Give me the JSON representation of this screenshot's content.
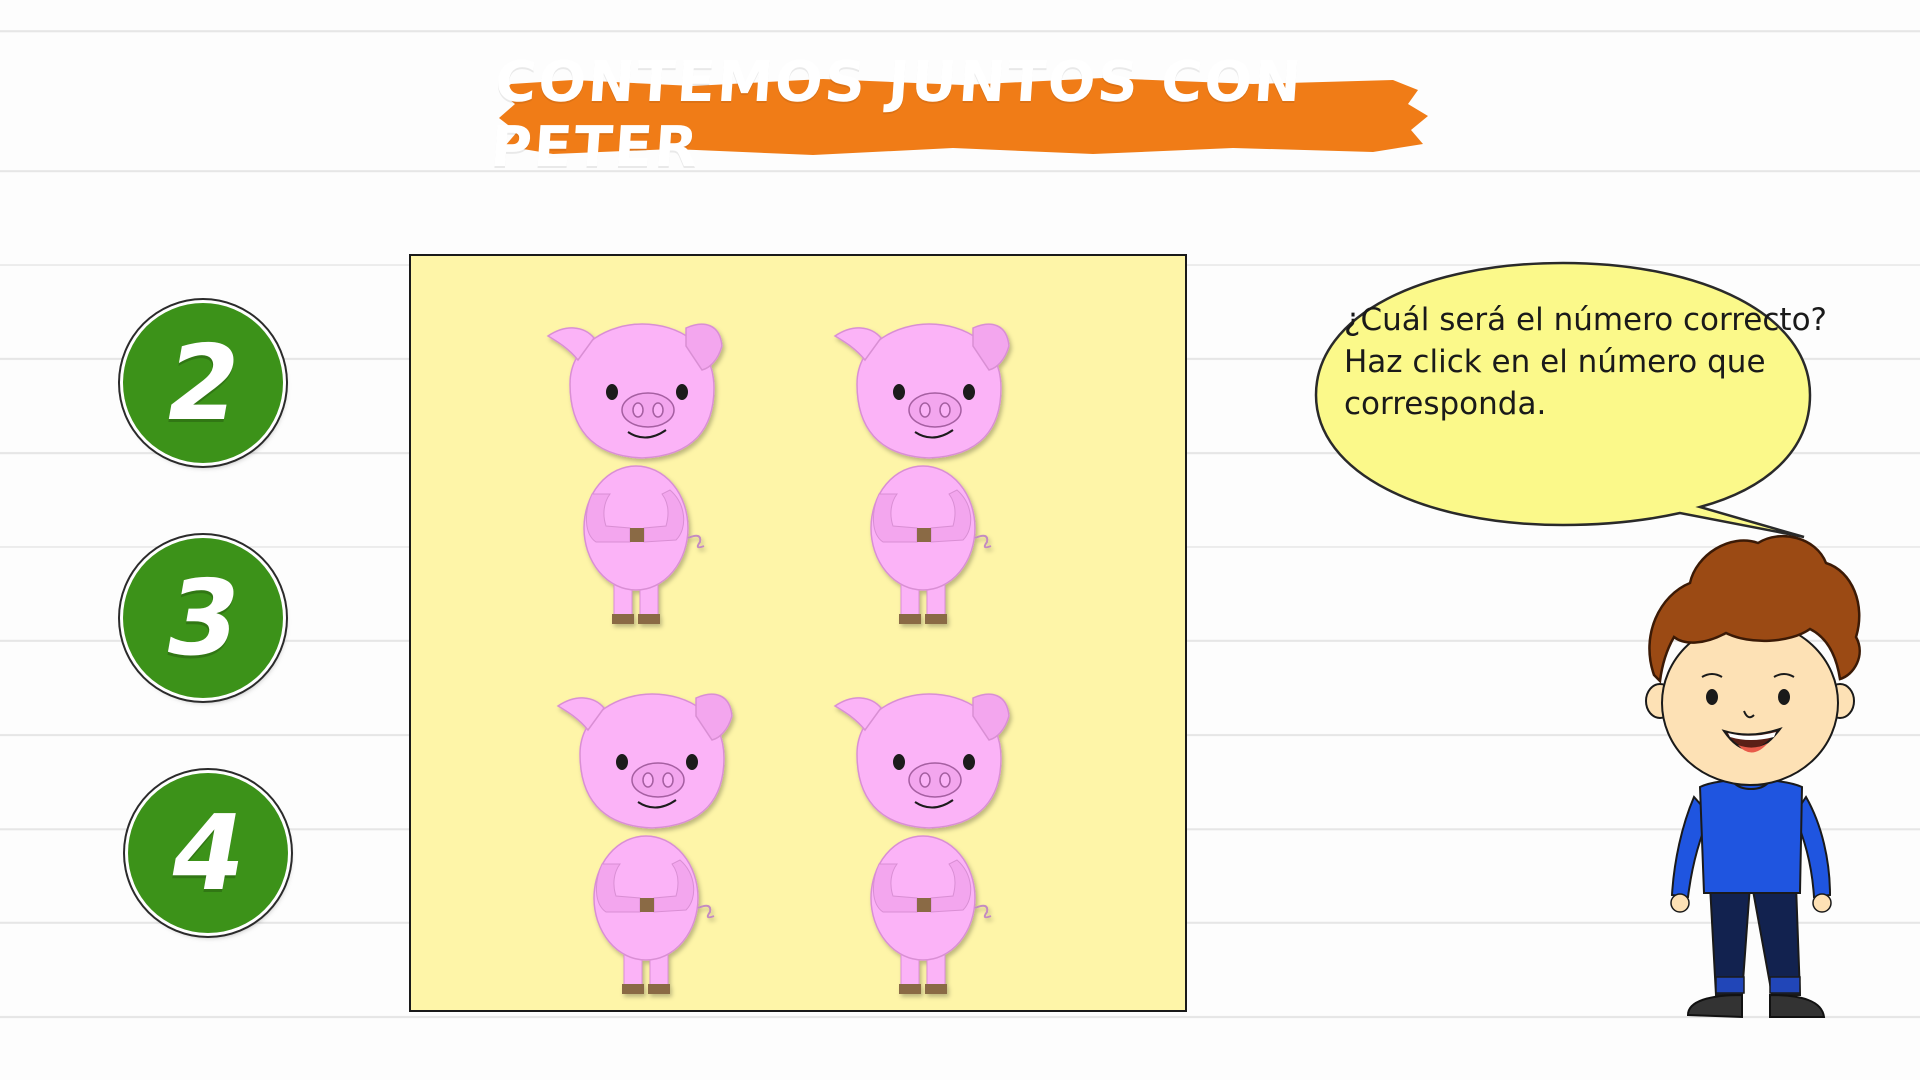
{
  "title": "CONTEMOS JUNTOS CON PETER",
  "options": [
    {
      "label": "2"
    },
    {
      "label": "3"
    },
    {
      "label": "4"
    }
  ],
  "speech": {
    "line1": "¿Cuál será el número correcto?",
    "line2": "Haz click en el número que",
    "line3": "corresponda."
  },
  "panel": {
    "items": [
      "pig-icon",
      "pig-icon",
      "pig-icon",
      "pig-icon"
    ]
  },
  "colors": {
    "title_banner": "#f07c17",
    "option_circle": "#3c9219",
    "panel_background": "#fef5a8",
    "bubble": "#fbf98a",
    "pig_body": "#fbb3f7",
    "shirt": "#1f55e0"
  }
}
